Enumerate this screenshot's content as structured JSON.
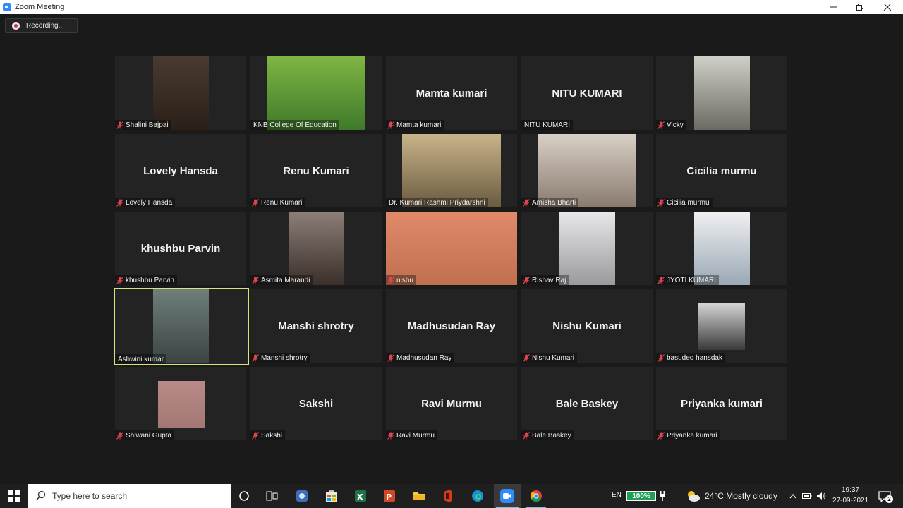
{
  "window": {
    "title": "Zoom Meeting"
  },
  "recording": {
    "label": "Recording..."
  },
  "participants": [
    {
      "name": "Shalini Bajpai",
      "muted": true,
      "video": true,
      "active": false
    },
    {
      "name": "KNB College Of Education",
      "muted": false,
      "video": true,
      "active": false
    },
    {
      "name": "Mamta kumari",
      "muted": true,
      "video": false,
      "active": false
    },
    {
      "name": "NITU KUMARI",
      "muted": false,
      "video": false,
      "active": false
    },
    {
      "name": "Vicky",
      "muted": true,
      "video": true,
      "active": false
    },
    {
      "name": "Lovely Hansda",
      "muted": true,
      "video": false,
      "active": false
    },
    {
      "name": "Renu Kumari",
      "muted": true,
      "video": false,
      "active": false
    },
    {
      "name": "Dr. Kumari Rashmi Priydarshni",
      "muted": false,
      "video": true,
      "active": false
    },
    {
      "name": "Amisha Bharti",
      "muted": true,
      "video": true,
      "active": false
    },
    {
      "name": "Cicilia murmu",
      "muted": true,
      "video": false,
      "active": false
    },
    {
      "name": "khushbu Parvin",
      "muted": true,
      "video": false,
      "active": false
    },
    {
      "name": "Asmita Marandi",
      "muted": true,
      "video": true,
      "active": false
    },
    {
      "name": "nishu",
      "muted": true,
      "video": true,
      "active": false
    },
    {
      "name": "Rishav Raj",
      "muted": true,
      "video": true,
      "active": false
    },
    {
      "name": "JYOTI KUMARI",
      "muted": true,
      "video": true,
      "active": false
    },
    {
      "name": "Ashwini kumar",
      "muted": false,
      "video": true,
      "active": true
    },
    {
      "name": "Manshi shrotry",
      "muted": true,
      "video": false,
      "active": false
    },
    {
      "name": "Madhusudan Ray",
      "muted": true,
      "video": false,
      "active": false
    },
    {
      "name": "Nishu Kumari",
      "muted": true,
      "video": false,
      "active": false
    },
    {
      "name": "basudeo hansdak",
      "muted": true,
      "video": true,
      "active": false
    },
    {
      "name": "Shiwani Gupta",
      "muted": true,
      "video": true,
      "active": false
    },
    {
      "name": "Sakshi",
      "muted": true,
      "video": false,
      "active": false
    },
    {
      "name": "Ravi Murmu",
      "muted": true,
      "video": false,
      "active": false
    },
    {
      "name": "Bale Baskey",
      "muted": true,
      "video": false,
      "active": false
    },
    {
      "name": "Priyanka kumari",
      "muted": true,
      "video": false,
      "active": false
    }
  ],
  "taskbar": {
    "search_placeholder": "Type here to search",
    "language": "EN",
    "battery": "100%",
    "weather": "24°C  Mostly cloudy",
    "time": "19:37",
    "date": "27-09-2021",
    "notification_count": "2"
  },
  "colors": {
    "accent": "#2d8cff",
    "active_speaker": "#d9e57a",
    "mute": "#e0464d"
  }
}
